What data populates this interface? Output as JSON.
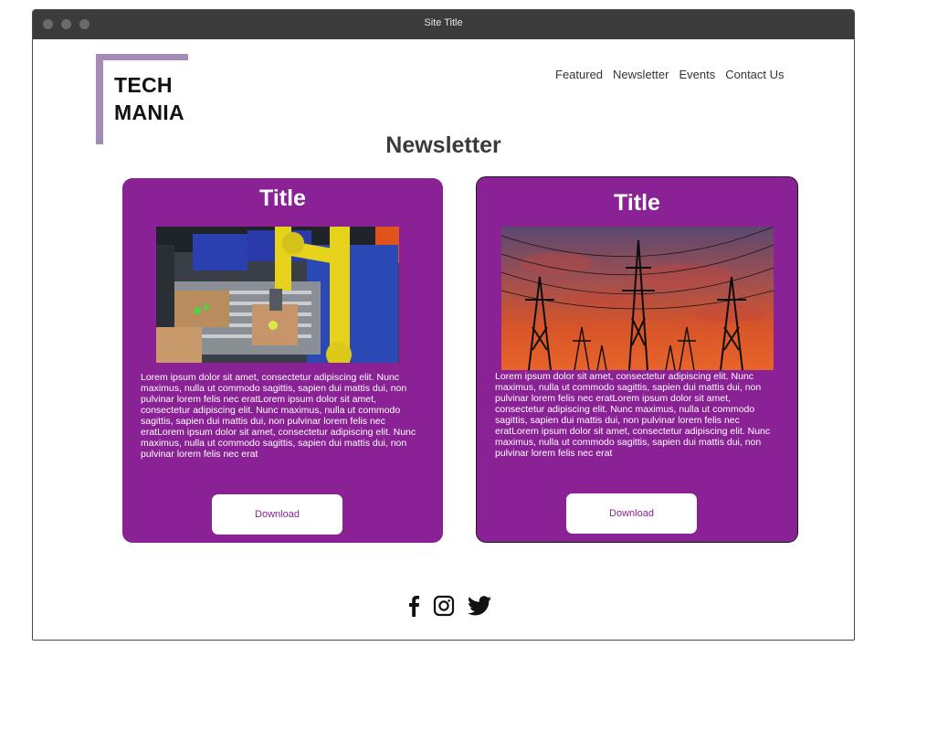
{
  "window": {
    "title": "Site Title"
  },
  "logo": {
    "line1": "TECH",
    "line2": "MANIA",
    "accent_color": "#a68bb8"
  },
  "nav": {
    "items": [
      {
        "label": "Featured"
      },
      {
        "label": "Newsletter"
      },
      {
        "label": "Events"
      },
      {
        "label": "Contact Us"
      }
    ]
  },
  "main": {
    "heading": "Newsletter",
    "cards": [
      {
        "title": "Title",
        "image": "robotic-arm-factory-image",
        "body": "Lorem ipsum dolor sit amet, consectetur adipiscing elit. Nunc maximus, nulla ut commodo sagittis, sapien dui mattis dui, non pulvinar lorem felis nec eratLorem ipsum dolor sit amet, consectetur adipiscing elit. Nunc maximus, nulla ut commodo sagittis, sapien dui mattis dui, non pulvinar lorem felis nec eratLorem ipsum dolor sit amet, consectetur adipiscing elit. Nunc maximus, nulla ut commodo sagittis, sapien dui mattis dui, non pulvinar lorem felis nec erat",
        "button_label": "Download"
      },
      {
        "title": "Title",
        "image": "power-pylons-sunset-image",
        "body": "Lorem ipsum dolor sit amet, consectetur adipiscing elit. Nunc maximus, nulla ut commodo sagittis, sapien dui mattis dui, non pulvinar lorem felis nec eratLorem ipsum dolor sit amet, consectetur adipiscing elit. Nunc maximus, nulla ut commodo sagittis, sapien dui mattis dui, non pulvinar lorem felis nec eratLorem ipsum dolor sit amet, consectetur adipiscing elit. Nunc maximus, nulla ut commodo sagittis, sapien dui mattis dui, non pulvinar lorem felis nec erat",
        "button_label": "Download"
      }
    ],
    "card_color": "#8a2195"
  },
  "footer": {
    "social_icons": [
      "facebook-icon",
      "instagram-icon",
      "twitter-icon"
    ]
  }
}
